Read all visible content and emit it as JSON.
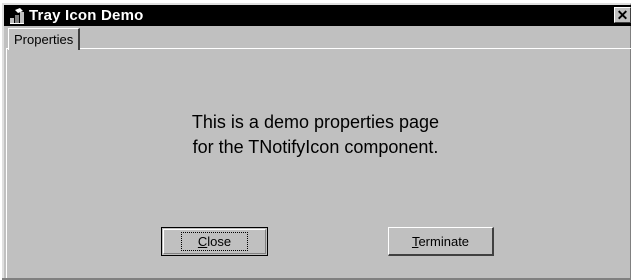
{
  "window": {
    "title": "Tray Icon Demo",
    "close_glyph": "✕",
    "icon": "tray-app-icon"
  },
  "tabs": [
    {
      "label": "Properties",
      "selected": true
    }
  ],
  "message": {
    "line1": "This is a demo properties page",
    "line2": "for the TNotifyIcon component."
  },
  "buttons": {
    "close": {
      "label_accel": "C",
      "label_rest": "lose",
      "default": true
    },
    "terminate": {
      "label_accel": "T",
      "label_rest": "erminate"
    }
  },
  "colors": {
    "face": "#c0c0c0",
    "titlebar": "#000000",
    "title_text": "#ffffff"
  }
}
